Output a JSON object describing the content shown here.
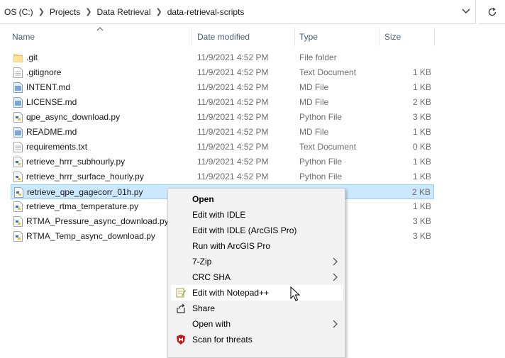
{
  "address_bar": {
    "crumbs": [
      "OS (C:)",
      "Projects",
      "Data Retrieval",
      "data-retrieval-scripts"
    ]
  },
  "columns": {
    "name": "Name",
    "date": "Date modified",
    "type": "Type",
    "size": "Size"
  },
  "files": [
    {
      "name": ".git",
      "date": "11/9/2021 4:52 PM",
      "type": "File folder",
      "size": "",
      "icon": "folder-icon"
    },
    {
      "name": ".gitignore",
      "date": "11/9/2021 4:52 PM",
      "type": "Text Document",
      "size": "1 KB",
      "icon": "text-file-icon"
    },
    {
      "name": "INTENT.md",
      "date": "11/9/2021 4:52 PM",
      "type": "MD File",
      "size": "1 KB",
      "icon": "md-file-icon"
    },
    {
      "name": "LICENSE.md",
      "date": "11/9/2021 4:52 PM",
      "type": "MD File",
      "size": "2 KB",
      "icon": "md-file-icon"
    },
    {
      "name": "qpe_async_download.py",
      "date": "11/9/2021 4:52 PM",
      "type": "Python File",
      "size": "3 KB",
      "icon": "python-file-icon"
    },
    {
      "name": "README.md",
      "date": "11/9/2021 4:52 PM",
      "type": "MD File",
      "size": "1 KB",
      "icon": "md-file-icon"
    },
    {
      "name": "requirements.txt",
      "date": "11/9/2021 4:52 PM",
      "type": "Text Document",
      "size": "0 KB",
      "icon": "text-file-icon"
    },
    {
      "name": "retrieve_hrrr_subhourly.py",
      "date": "11/9/2021 4:52 PM",
      "type": "Python File",
      "size": "1 KB",
      "icon": "python-file-icon"
    },
    {
      "name": "retrieve_hrrr_surface_hourly.py",
      "date": "11/9/2021 4:52 PM",
      "type": "Python File",
      "size": "1 KB",
      "icon": "python-file-icon"
    },
    {
      "name": "retrieve_qpe_gagecorr_01h.py",
      "date": "",
      "type": "",
      "size": "2 KB",
      "icon": "python-file-icon",
      "selected": true
    },
    {
      "name": "retrieve_rtma_temperature.py",
      "date": "",
      "type": "",
      "size": "1 KB",
      "icon": "python-file-icon"
    },
    {
      "name": "RTMA_Pressure_async_download.py",
      "date": "",
      "type": "",
      "size": "3 KB",
      "icon": "python-file-icon"
    },
    {
      "name": "RTMA_Temp_async_download.py",
      "date": "",
      "type": "",
      "size": "3 KB",
      "icon": "python-file-icon"
    }
  ],
  "context_menu": {
    "items": [
      {
        "label": "Open",
        "bold": true
      },
      {
        "label": "Edit with IDLE"
      },
      {
        "label": "Edit with IDLE (ArcGIS Pro)"
      },
      {
        "label": "Run with ArcGIS Pro"
      },
      {
        "label": "7-Zip",
        "submenu": true
      },
      {
        "label": "CRC SHA",
        "submenu": true
      },
      {
        "label": "Edit with Notepad++",
        "icon": "notepad-plus-plus-icon",
        "hover": true
      },
      {
        "label": "Share",
        "icon": "share-icon"
      },
      {
        "label": "Open with",
        "submenu": true
      },
      {
        "label": "Scan for threats",
        "icon": "mcafee-shield-icon"
      }
    ]
  },
  "colors": {
    "selection_bg": "#cce8ff",
    "selection_border": "#99d1ff",
    "header_text": "#4c607a",
    "menu_bg": "#f2f2f2",
    "mcafee_red": "#c01818"
  }
}
